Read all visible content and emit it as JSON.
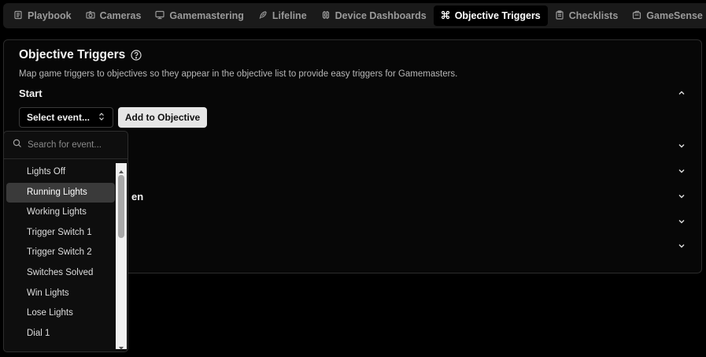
{
  "tabs": [
    {
      "label": "Playbook",
      "icon": "playbook-icon",
      "active": false
    },
    {
      "label": "Cameras",
      "icon": "camera-icon",
      "active": false
    },
    {
      "label": "Gamemastering",
      "icon": "monitor-icon",
      "active": false
    },
    {
      "label": "Lifeline",
      "icon": "feather-icon",
      "active": false
    },
    {
      "label": "Device Dashboards",
      "icon": "chip-icon",
      "active": false
    },
    {
      "label": "Objective Triggers",
      "icon": "command-icon",
      "active": true
    },
    {
      "label": "Checklists",
      "icon": "clipboard-icon",
      "active": false
    },
    {
      "label": "GameSense",
      "icon": "gamesense-icon",
      "active": false
    }
  ],
  "card": {
    "title": "Objective Triggers",
    "description": "Map game triggers to objectives so they appear in the objective list to provide easy triggers for Gamemasters.",
    "section_label": "Start",
    "partial_label": "en"
  },
  "controls": {
    "select_label": "Select event...",
    "add_label": "Add to Objective"
  },
  "dropdown": {
    "search_placeholder": "Search for event...",
    "items": [
      "Lights Off",
      "Running Lights",
      "Working Lights",
      "Trigger Switch 1",
      "Trigger Switch 2",
      "Switches Solved",
      "Win Lights",
      "Lose Lights",
      "Dial 1"
    ],
    "highlighted": "Running Lights"
  },
  "colors": {
    "background": "#000000",
    "panel": "#1a1a1a",
    "accent": "#e6e6e6"
  }
}
